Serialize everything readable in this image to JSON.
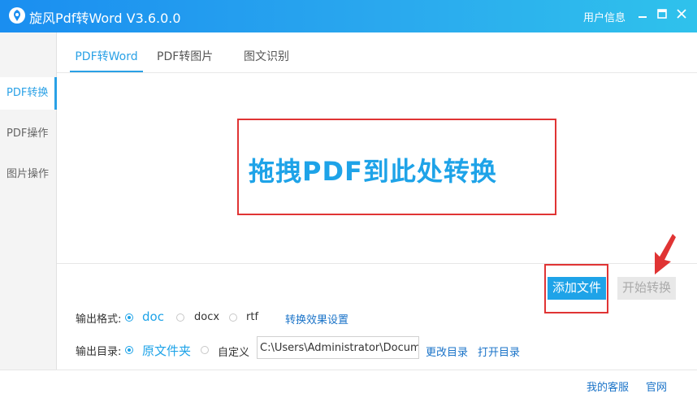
{
  "titlebar": {
    "title": "旋风Pdf转Word V3.6.0.0",
    "user_info": "用户信息",
    "icons": [
      "app-logo-icon",
      "minimize-icon",
      "maximize-icon",
      "close-icon"
    ]
  },
  "sidebar": {
    "items": [
      {
        "label": "PDF转换",
        "active": true
      },
      {
        "label": "PDF操作",
        "active": false
      },
      {
        "label": "图片操作",
        "active": false
      }
    ]
  },
  "tabs": [
    {
      "label": "PDF转Word",
      "active": true
    },
    {
      "label": "PDF转图片",
      "active": false
    },
    {
      "label": "图文识别",
      "active": false
    }
  ],
  "drop_zone": {
    "text": "拖拽PDF到此处转换"
  },
  "actions": {
    "add_file": "添加文件",
    "start_convert": "开始转换"
  },
  "output_format": {
    "label": "输出格式:",
    "options": [
      "doc",
      "docx",
      "rtf"
    ],
    "selected": "doc",
    "settings_link": "转换效果设置"
  },
  "output_dir": {
    "label": "输出目录:",
    "options": [
      "原文件夹",
      "自定义"
    ],
    "selected": "原文件夹",
    "path_value": "C:\\Users\\Administrator\\Docume",
    "change_link": "更改目录",
    "open_link": "打开目录"
  },
  "footer": {
    "support": "我的客服",
    "website": "官网"
  },
  "colors": {
    "accent": "#1ea3e8",
    "highlight": "#e03434"
  }
}
